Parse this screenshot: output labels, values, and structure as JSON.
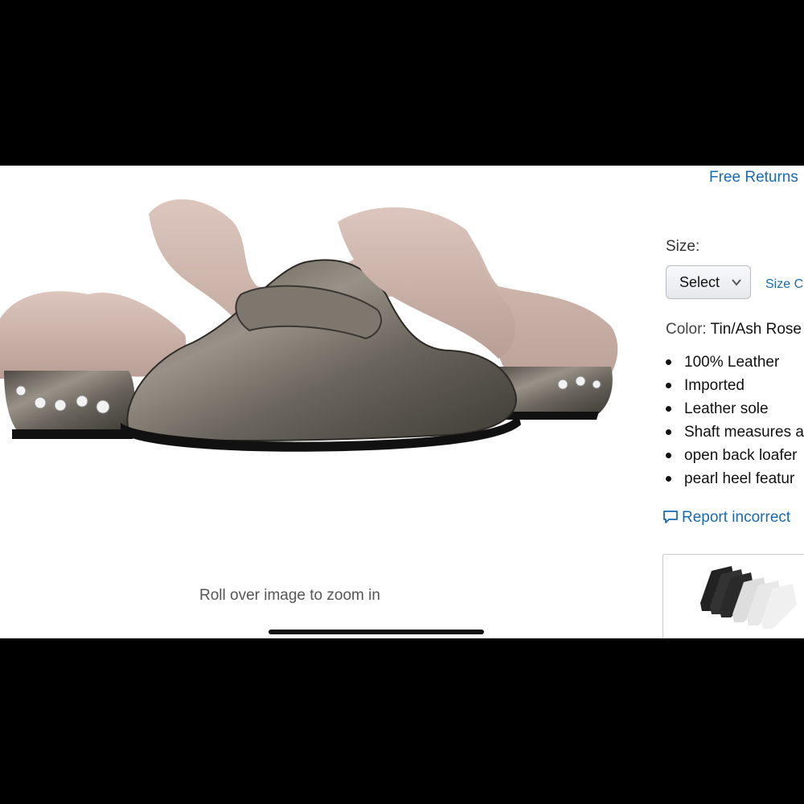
{
  "product": {
    "image_label": "fur-lined metallic loafer mule",
    "zoom_hint": "Roll over image to zoom in"
  },
  "details": {
    "free_returns": "Free Returns",
    "size_label": "Size:",
    "size_select_value": "Select",
    "size_chart_link": "Size C",
    "color_label": "Color:",
    "color_value": "Tin/Ash Rose",
    "bullets": [
      "100% Leather",
      "Imported",
      "Leather sole",
      "Shaft measures a",
      "open back loafer",
      "pearl heel featur"
    ],
    "report_link": "Report incorrect"
  },
  "colors": {
    "link": "#1a6ab0",
    "metallic_leather": "#6f6a62",
    "fur": "#c9b1a8"
  }
}
